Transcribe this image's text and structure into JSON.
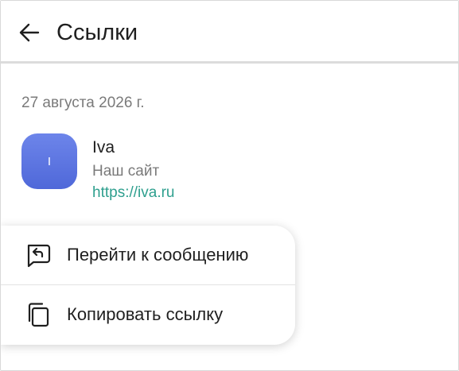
{
  "header": {
    "title": "Ссылки",
    "back_icon": "arrow-left-icon"
  },
  "links": {
    "date": "27 августа 2026 г.",
    "items": [
      {
        "avatar_letter": "I",
        "name": "Iva",
        "description": "Наш сайт",
        "url": "https://iva.ru"
      }
    ]
  },
  "context_menu": {
    "items": [
      {
        "label": "Перейти к сообщению",
        "icon": "go-to-message-icon"
      },
      {
        "label": "Копировать ссылку",
        "icon": "copy-icon"
      }
    ]
  },
  "colors": {
    "accent_link": "#2e9f8e",
    "avatar_gradient_top": "#6d85ea",
    "avatar_gradient_bottom": "#4f68d9",
    "text_primary": "#1f1f1f",
    "text_secondary": "#7a7a7a"
  }
}
